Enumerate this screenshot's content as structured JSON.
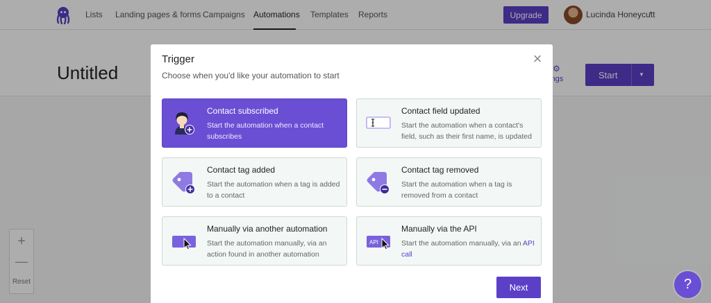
{
  "nav": {
    "items": [
      "Lists",
      "Landing pages & forms",
      "Campaigns",
      "Automations",
      "Templates",
      "Reports"
    ],
    "upgrade_label": "Upgrade",
    "user_name": "Lucinda Honeycutt"
  },
  "header": {
    "title": "Untitled",
    "settings_label": "ttings",
    "start_label": "Start"
  },
  "zoom": {
    "in": "+",
    "out": "—",
    "reset": "Reset"
  },
  "modal": {
    "title": "Trigger",
    "subtitle": "Choose when you'd like your automation to start",
    "close": "×",
    "options": [
      {
        "title": "Contact subscribed",
        "desc": "Start the automation when a contact subscribes",
        "icon": "contact-add-icon",
        "selected": true
      },
      {
        "title": "Contact field updated",
        "desc": "Start the automation when a contact's field, such as their first name, is updated",
        "icon": "text-field-icon",
        "selected": false
      },
      {
        "title": "Contact tag added",
        "desc": "Start the automation when a tag is added to a contact",
        "icon": "tag-add-icon",
        "selected": false
      },
      {
        "title": "Contact tag removed",
        "desc": "Start the automation when a tag is removed from a contact",
        "icon": "tag-remove-icon",
        "selected": false
      },
      {
        "title": "Manually via another automation",
        "desc": "Start the automation manually, via an action found in another automation",
        "icon": "cursor-button-icon",
        "selected": false
      },
      {
        "title": "Manually via the API",
        "desc": "Start the automation manually, via an",
        "link": "API call",
        "icon": "api-cursor-icon",
        "selected": false
      }
    ],
    "next_label": "Next"
  },
  "help_label": "?",
  "colors": {
    "accent": "#5c3fc7",
    "selected_card": "#6a4fd4",
    "card_bg": "#f3f7f5"
  }
}
